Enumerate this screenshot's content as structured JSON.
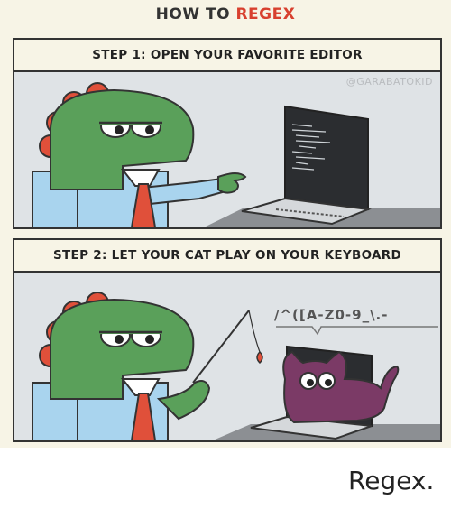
{
  "comic": {
    "title_prefix": "HOW TO ",
    "title_accent": "REGEX",
    "credit": "@GARABATOKID",
    "panels": [
      {
        "caption": "STEP 1: OPEN YOUR FAVORITE EDITOR"
      },
      {
        "caption": "STEP 2: LET YOUR CAT PLAY ON YOUR KEYBOARD",
        "regex_text": "/^([A-Z0-9_\\.-"
      }
    ]
  },
  "post_caption": "Regex.",
  "colors": {
    "accent": "#d8402f",
    "dino": "#5aa05a",
    "shirt": "#a9d4ee",
    "tie": "#e0503a",
    "cat": "#7b3a66"
  }
}
